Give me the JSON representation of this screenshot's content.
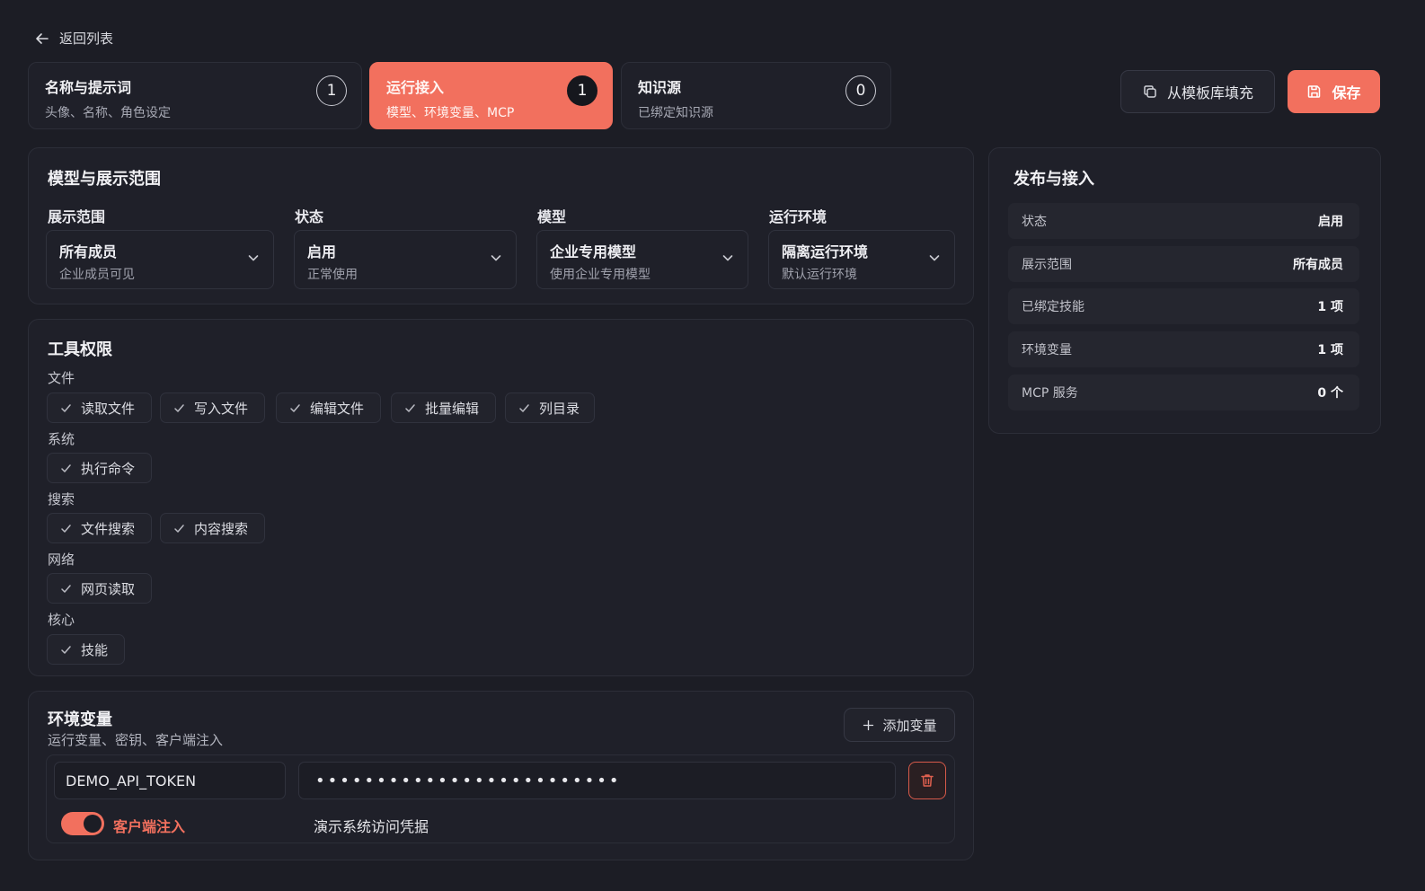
{
  "back": {
    "label": "返回列表"
  },
  "steps": [
    {
      "title": "名称与提示词",
      "subtitle": "头像、名称、角色设定",
      "count": "1"
    },
    {
      "title": "运行接入",
      "subtitle": "模型、环境变量、MCP",
      "count": "1"
    },
    {
      "title": "知识源",
      "subtitle": "已绑定知识源",
      "count": "0"
    }
  ],
  "actions": {
    "template_label": "从模板库填充",
    "save_label": "保存"
  },
  "model_section": {
    "title": "模型与展示范围",
    "fields": [
      {
        "label": "展示范围",
        "value": "所有成员",
        "desc": "企业成员可见"
      },
      {
        "label": "状态",
        "value": "启用",
        "desc": "正常使用"
      },
      {
        "label": "模型",
        "value": "企业专用模型",
        "desc": "使用企业专用模型"
      },
      {
        "label": "运行环境",
        "value": "隔离运行环境",
        "desc": "默认运行环境"
      }
    ]
  },
  "tools": {
    "title": "工具权限",
    "groups": [
      {
        "label": "文件",
        "items": [
          "读取文件",
          "写入文件",
          "编辑文件",
          "批量编辑",
          "列目录"
        ]
      },
      {
        "label": "系统",
        "items": [
          "执行命令"
        ]
      },
      {
        "label": "搜索",
        "items": [
          "文件搜索",
          "内容搜索"
        ]
      },
      {
        "label": "网络",
        "items": [
          "网页读取"
        ]
      },
      {
        "label": "核心",
        "items": [
          "技能"
        ]
      }
    ]
  },
  "env": {
    "title": "环境变量",
    "subtitle": "运行变量、密钥、客户端注入",
    "add_label": "添加变量",
    "var_name": "DEMO_API_TOKEN",
    "var_value": "•••••••••••••••••••••••••",
    "inject_label": "客户端注入",
    "note": "演示系统访问凭据"
  },
  "publish": {
    "title": "发布与接入",
    "rows": [
      {
        "key": "状态",
        "value": "启用"
      },
      {
        "key": "展示范围",
        "value": "所有成员"
      },
      {
        "key": "已绑定技能",
        "value": "1 项"
      },
      {
        "key": "环境变量",
        "value": "1 项"
      },
      {
        "key": "MCP 服务",
        "value": "0 个"
      }
    ]
  },
  "colors": {
    "accent": "#f2705e",
    "background": "#1c1d25",
    "card": "#1f2029"
  }
}
